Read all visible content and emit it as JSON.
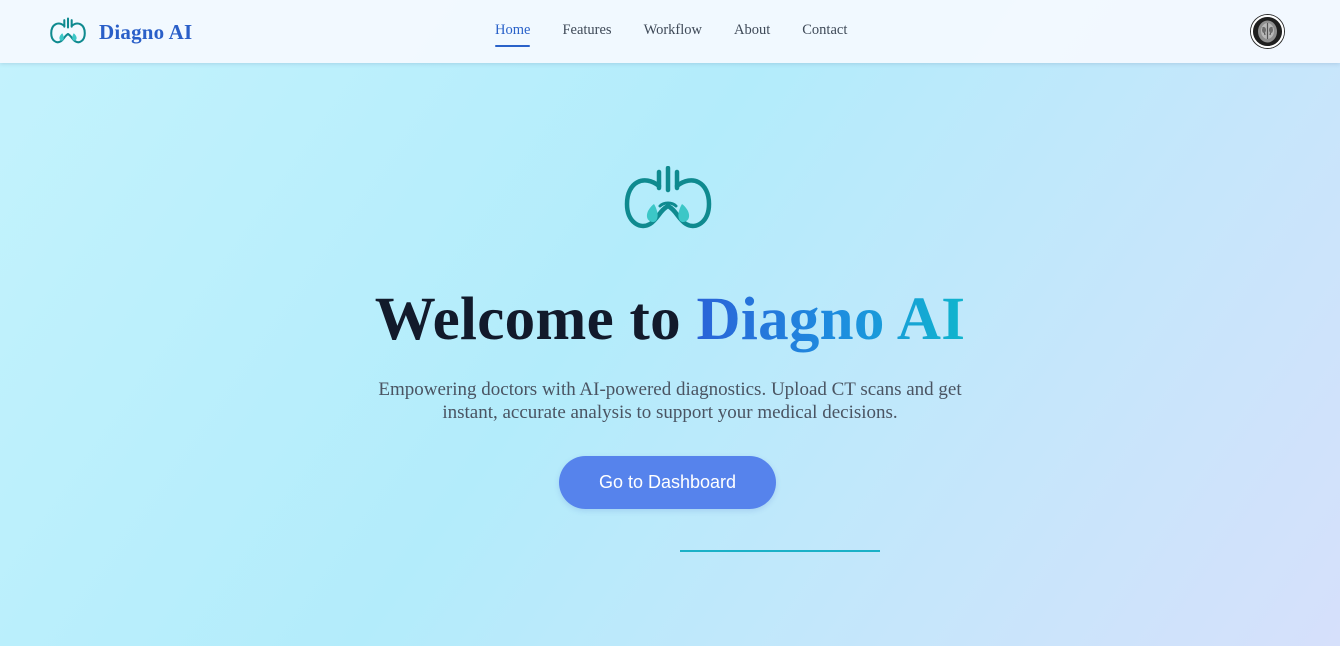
{
  "header": {
    "brand_name": "Diagno AI",
    "brand_icon": "lungs-icon",
    "nav": [
      {
        "label": "Home",
        "active": true
      },
      {
        "label": "Features",
        "active": false
      },
      {
        "label": "Workflow",
        "active": false
      },
      {
        "label": "About",
        "active": false
      },
      {
        "label": "Contact",
        "active": false
      }
    ],
    "avatar_icon": "user-avatar"
  },
  "hero": {
    "icon": "lungs-icon",
    "title_prefix": "Welcome to",
    "title_accent": "Diagno AI",
    "subtitle": "Empowering doctors with AI-powered diagnostics. Upload CT scans and get instant, accurate analysis to support your medical decisions.",
    "cta_label": "Go to Dashboard"
  },
  "colors": {
    "brand": "#2a5fc8",
    "accent_gradient_start": "#2a63d8",
    "accent_gradient_end": "#10b5cd",
    "cta_background": "#5683ec",
    "lung_icon": "#0f8a8f",
    "divider": "#1bb1c7"
  }
}
